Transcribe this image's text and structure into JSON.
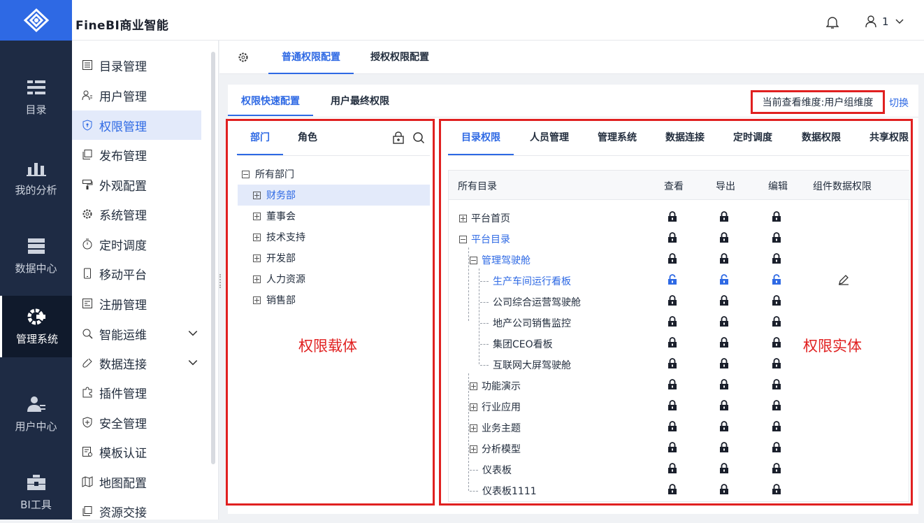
{
  "app": {
    "brand": "FineBI商业智能",
    "user_label": "1"
  },
  "rail": [
    {
      "label": "目录",
      "icon": "catalog-icon"
    },
    {
      "label": "我的分析",
      "icon": "analysis-icon"
    },
    {
      "label": "数据中心",
      "icon": "data-center-icon"
    },
    {
      "label": "管理系统",
      "icon": "admin-gear-icon",
      "active": true
    },
    {
      "label": "用户中心",
      "icon": "user-center-icon"
    },
    {
      "label": "BI工具",
      "icon": "toolbox-icon"
    }
  ],
  "menu": [
    {
      "label": "目录管理"
    },
    {
      "label": "用户管理"
    },
    {
      "label": "权限管理",
      "active": true
    },
    {
      "label": "发布管理"
    },
    {
      "label": "外观配置"
    },
    {
      "label": "系统管理"
    },
    {
      "label": "定时调度"
    },
    {
      "label": "移动平台"
    },
    {
      "label": "注册管理"
    },
    {
      "label": "智能运维",
      "expand": true
    },
    {
      "label": "数据连接",
      "expand": true
    },
    {
      "label": "插件管理"
    },
    {
      "label": "安全管理"
    },
    {
      "label": "模板认证"
    },
    {
      "label": "地图配置"
    },
    {
      "label": "资源交接"
    }
  ],
  "main_tabs": {
    "normal": "普通权限配置",
    "grant": "授权权限配置"
  },
  "sub_tabs": {
    "quick": "权限快速配置",
    "final": "用户最终权限"
  },
  "dimension_text": "当前查看维度:用户组维度",
  "switch_label": "切换",
  "left_tabs": {
    "dept": "部门",
    "role": "角色"
  },
  "dept_tree": {
    "root": "所有部门",
    "children": [
      "财务部",
      "董事会",
      "技术支持",
      "开发部",
      "人力资源",
      "销售部"
    ]
  },
  "left_annotation": "权限载体",
  "right_annotation": "权限实体",
  "right_tabs": [
    "目录权限",
    "人员管理",
    "管理系统",
    "数据连接",
    "定时调度",
    "数据权限",
    "共享权限"
  ],
  "table": {
    "headers": {
      "name": "所有目录",
      "view": "查看",
      "export": "导出",
      "edit": "编辑",
      "component": "组件数据权限"
    },
    "rows": [
      {
        "label": "平台首页",
        "lock": "locked"
      },
      {
        "label": "平台目录",
        "lock": "locked"
      },
      {
        "label": "管理驾驶舱",
        "lock": "locked"
      },
      {
        "label": "生产车间运行看板",
        "lock": "unlocked"
      },
      {
        "label": "公司综合运营驾驶舱",
        "lock": "locked"
      },
      {
        "label": "地产公司销售监控",
        "lock": "locked"
      },
      {
        "label": "集团CEO看板",
        "lock": "locked"
      },
      {
        "label": "互联网大屏驾驶舱",
        "lock": "locked"
      },
      {
        "label": "功能演示",
        "lock": "locked"
      },
      {
        "label": "行业应用",
        "lock": "locked"
      },
      {
        "label": "业务主题",
        "lock": "locked"
      },
      {
        "label": "分析模型",
        "lock": "locked"
      },
      {
        "label": "仪表板",
        "lock": "locked"
      },
      {
        "label": "仪表板1111",
        "lock": "locked"
      }
    ]
  },
  "colors": {
    "accent": "#2e69e4",
    "rail_bg": "#1e2b44",
    "highlight_red": "#e02020"
  }
}
